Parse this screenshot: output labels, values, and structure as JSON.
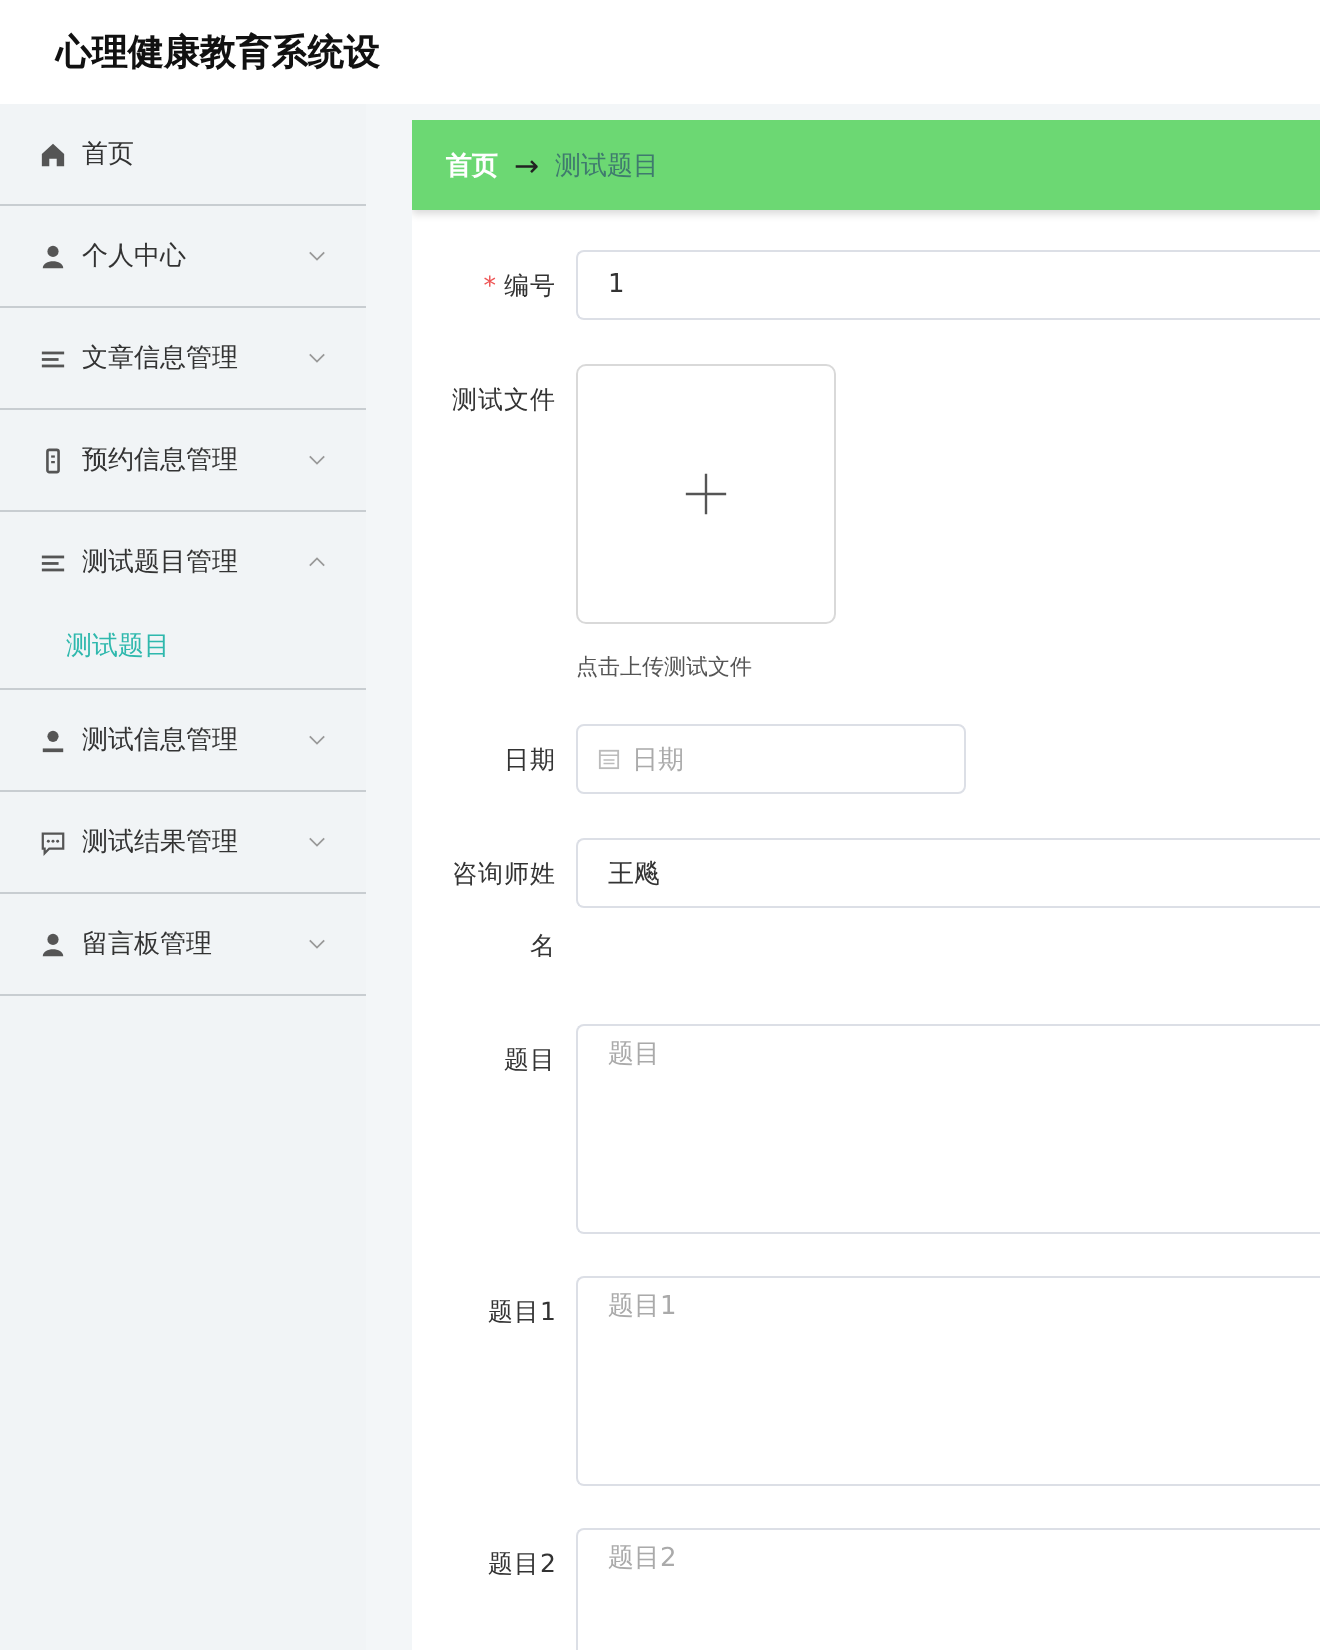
{
  "app_title": "心理健康教育系统设",
  "sidebar": {
    "items": [
      {
        "kind": "link",
        "label": "首页"
      },
      {
        "kind": "submenu",
        "label": "个人中心",
        "expanded": false
      },
      {
        "kind": "submenu",
        "label": "文章信息管理",
        "expanded": false
      },
      {
        "kind": "submenu",
        "label": "预约信息管理",
        "expanded": false
      },
      {
        "kind": "submenu",
        "label": "测试题目管理",
        "expanded": true,
        "children": [
          {
            "label": "测试题目",
            "selected": true
          }
        ]
      },
      {
        "kind": "submenu",
        "label": "测试信息管理",
        "expanded": false
      },
      {
        "kind": "submenu",
        "label": "测试结果管理",
        "expanded": false
      },
      {
        "kind": "submenu",
        "label": "留言板管理",
        "expanded": false
      }
    ]
  },
  "breadcrumb": {
    "home": "首页",
    "separator": "→",
    "current": "测试题目"
  },
  "form": {
    "fields": [
      {
        "kind": "input",
        "label": "编号",
        "required_mark": "*",
        "value": "1"
      },
      {
        "kind": "upload",
        "label": "测试文件",
        "hint": "点击上传测试文件"
      },
      {
        "kind": "date",
        "label": "日期",
        "placeholder": "日期"
      },
      {
        "kind": "input",
        "label": "咨询师姓名",
        "value": "王飚"
      },
      {
        "kind": "textarea",
        "label": "题目",
        "placeholder": "题目"
      },
      {
        "kind": "textarea",
        "label": "题目1",
        "placeholder": "题目1"
      },
      {
        "kind": "textarea",
        "label": "题目2",
        "placeholder": "题目2"
      }
    ]
  }
}
